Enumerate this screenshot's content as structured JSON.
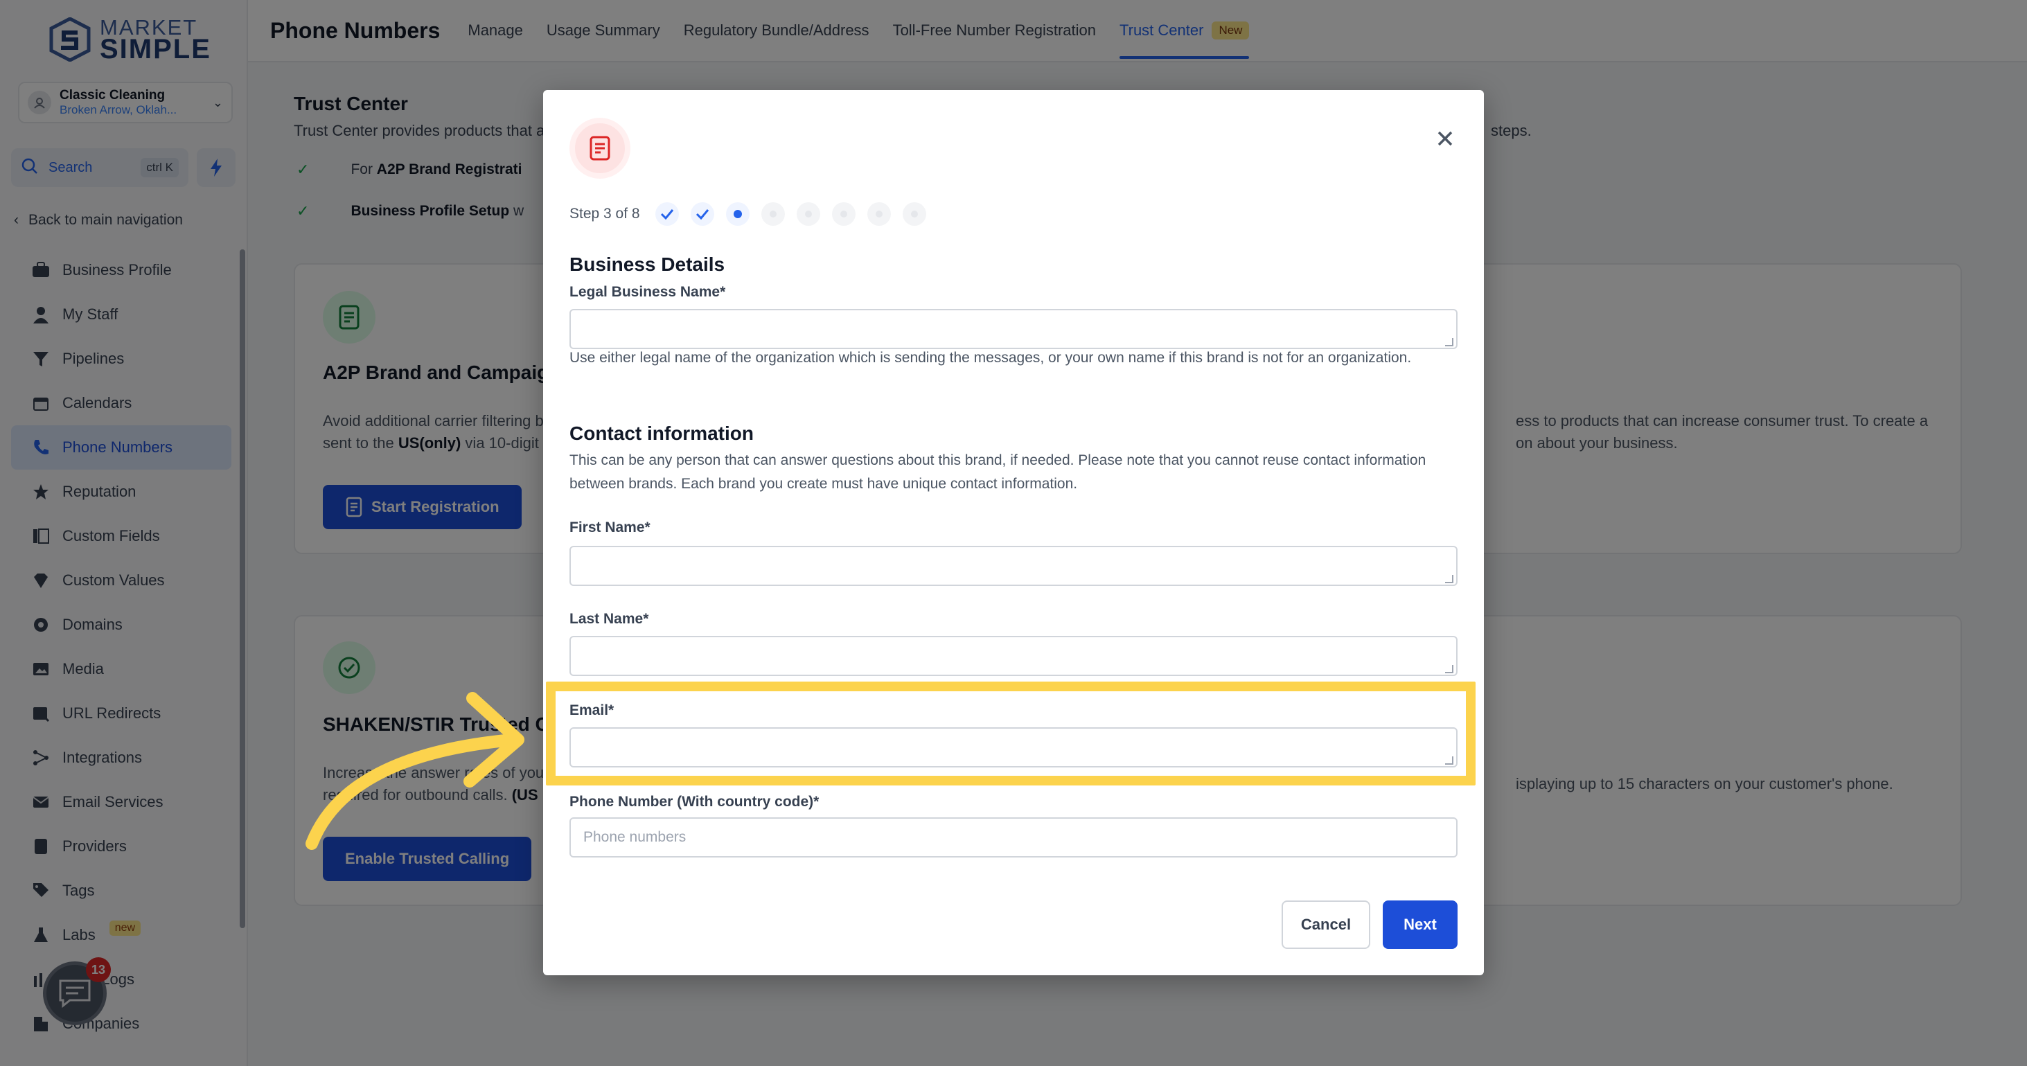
{
  "brand": {
    "logo_line1": "MARKET",
    "logo_line2": "SIMPLE"
  },
  "account": {
    "name": "Classic Cleaning",
    "location": "Broken Arrow, Oklah..."
  },
  "search": {
    "label": "Search",
    "shortcut": "ctrl K"
  },
  "sidebar": {
    "back_label": "Back to main navigation",
    "items": [
      {
        "label": "Business Profile",
        "icon": "briefcase-icon"
      },
      {
        "label": "My Staff",
        "icon": "user-icon"
      },
      {
        "label": "Pipelines",
        "icon": "funnel-icon"
      },
      {
        "label": "Calendars",
        "icon": "calendar-icon"
      },
      {
        "label": "Phone Numbers",
        "icon": "phone-icon",
        "active": true
      },
      {
        "label": "Reputation",
        "icon": "star-icon"
      },
      {
        "label": "Custom Fields",
        "icon": "fields-icon"
      },
      {
        "label": "Custom Values",
        "icon": "tag-icon"
      },
      {
        "label": "Domains",
        "icon": "globe-icon"
      },
      {
        "label": "Media",
        "icon": "image-icon"
      },
      {
        "label": "URL Redirects",
        "icon": "redirect-icon"
      },
      {
        "label": "Integrations",
        "icon": "integration-icon"
      },
      {
        "label": "Email Services",
        "icon": "mail-icon"
      },
      {
        "label": "Providers",
        "icon": "provider-icon"
      },
      {
        "label": "Tags",
        "icon": "tags-icon"
      },
      {
        "label": "Labs",
        "icon": "flask-icon",
        "badge": "new"
      },
      {
        "label": "Audit Logs",
        "icon": "log-icon"
      },
      {
        "label": "Companies",
        "icon": "building-icon"
      }
    ],
    "chat_badge": "13"
  },
  "header": {
    "title": "Phone Numbers",
    "tabs": [
      {
        "label": "Manage"
      },
      {
        "label": "Usage Summary"
      },
      {
        "label": "Regulatory Bundle/Address"
      },
      {
        "label": "Toll-Free Number Registration"
      },
      {
        "label": "Trust Center",
        "badge": "New",
        "active": true
      }
    ]
  },
  "main": {
    "trust_center_title": "Trust Center",
    "trust_center_desc": "Trust Center provides products that ai",
    "trust_center_desc_end": "steps.",
    "check1_prefix": "For ",
    "check1_bold": "A2P Brand Registrati",
    "check2_bold": "Business Profile Setup",
    "check2_suffix": " w",
    "card1": {
      "title": "A2P Brand and Campaign",
      "line1": "Avoid additional carrier filtering b",
      "line2_prefix": "sent to the ",
      "line2_bold": "US(only)",
      "line2_suffix": " via 10-digit l",
      "right1": "ess to products that can increase consumer trust. To create a",
      "right2": "on about your business.",
      "button": "Start Registration"
    },
    "card2": {
      "title": "SHAKEN/STIR Trusted Ca",
      "line1": "Increase the answer rates of you",
      "line2_prefix": "required for outbound calls. ",
      "line2_bold": "(US",
      "right1": "isplaying up to 15 characters on your customer's phone.",
      "button": "Enable Trusted Calling"
    }
  },
  "modal": {
    "step_label": "Step 3 of 8",
    "steps": [
      "done",
      "done",
      "current",
      "todo",
      "todo",
      "todo",
      "todo",
      "todo"
    ],
    "business_details_title": "Business Details",
    "legal_name_label": "Legal Business Name*",
    "legal_name_value": "",
    "legal_name_help": "Use either legal name of the organization which is sending the messages, or your own name if this brand is not for an organization.",
    "contact_title": "Contact information",
    "contact_help": "This can be any person that can answer questions about this brand, if needed. Please note that you cannot reuse contact information between brands. Each brand you create must have unique contact information.",
    "first_name_label": "First Name*",
    "first_name_value": "",
    "last_name_label": "Last Name*",
    "last_name_value": "",
    "email_label": "Email*",
    "email_value": "",
    "phone_label": "Phone Number (With country code)*",
    "phone_placeholder": "Phone numbers",
    "cancel_label": "Cancel",
    "next_label": "Next"
  },
  "colors": {
    "primary": "#1d4ed8",
    "highlight": "#fcd34d",
    "success": "#16a34a",
    "badge_new": "#fde68a"
  }
}
